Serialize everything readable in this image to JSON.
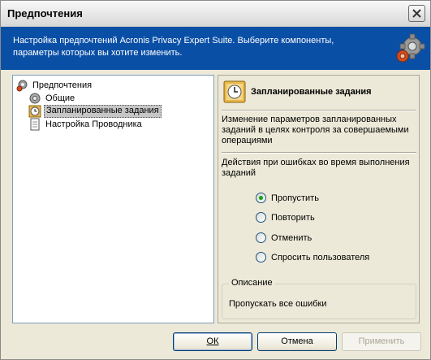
{
  "window": {
    "title": "Предпочтения"
  },
  "banner": {
    "text": "Настройка предпочтений Acronis Privacy Expert Suite. Выберите компоненты, параметры которых вы хотите изменить."
  },
  "tree": {
    "root": "Предпочтения",
    "items": [
      "Общие",
      "Запланированные задания",
      "Настройка Проводника"
    ],
    "selected_index": 1
  },
  "right_panel": {
    "title": "Запланированные задания",
    "description": "Изменение параметров запланированных заданий в целях контроля за совершаемыми операциями",
    "error_label": "Действия при ошибках во время выполнения заданий",
    "options": [
      "Пропустить",
      "Повторить",
      "Отменить",
      "Спросить пользователя"
    ],
    "selected_option": 0,
    "groupbox_title": "Описание",
    "groupbox_text": "Пропускать все ошибки"
  },
  "buttons": {
    "ok": "ОК",
    "cancel": "Отмена",
    "apply": "Применить"
  }
}
